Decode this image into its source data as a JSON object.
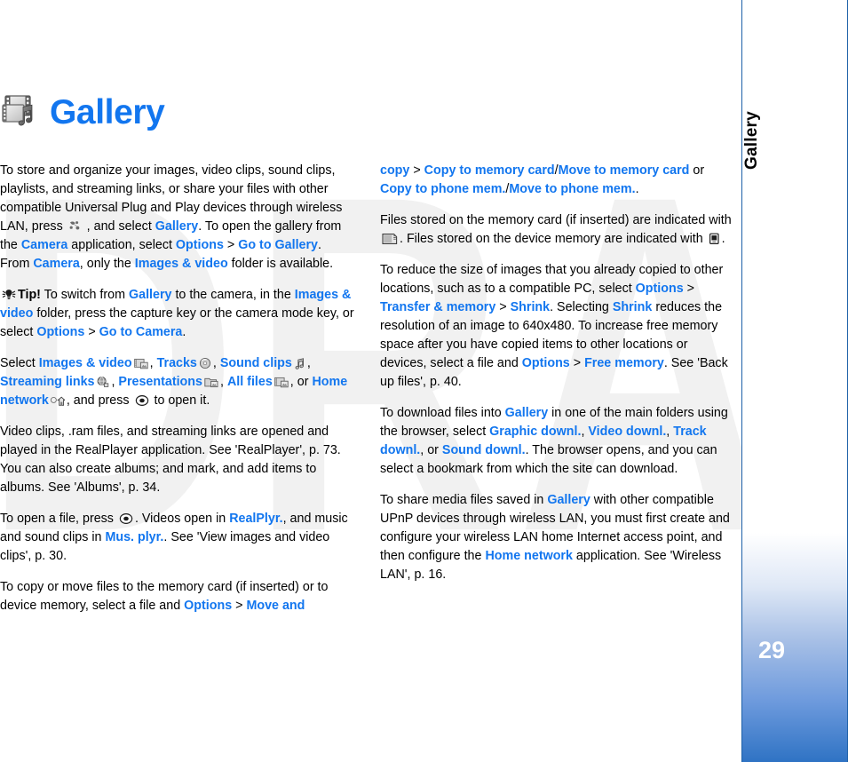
{
  "document": {
    "watermark": "DRAFT",
    "colors": {
      "accent_blue": "#1276ef",
      "sidebar_border": "#1d60a8",
      "sidebar_gradient_bottom": "#2f73c4",
      "text": "#000000",
      "watermark_gray": "#f1f1f1"
    }
  },
  "sidebar": {
    "chapter_label": "Gallery",
    "page_number": "29"
  },
  "heading": {
    "title": "Gallery",
    "icon": "gallery-filmstrip-note-icon"
  },
  "left_column": {
    "p1": {
      "t1": "To store and organize your images, video clips, sound clips, playlists, and streaming links, or share your files with other compatible Universal Plug and Play devices through wireless LAN, press ",
      "t2": " , and select ",
      "b1": "Gallery",
      "t3": ". To open the gallery from the ",
      "b2": "Camera",
      "t4": " application, select ",
      "b3": "Options",
      "sep1": " > ",
      "b4": "Go to Gallery",
      "t5": ". From ",
      "b5": "Camera",
      "t6": ", only the ",
      "b6": "Images & video",
      "t7": " folder is available."
    },
    "p2_tip": {
      "label": "Tip!",
      "t1": " To switch from ",
      "b1": "Gallery",
      "t2": " to the camera, in the ",
      "b2": "Images & video",
      "t3": " folder, press the capture key or the camera mode key, or select ",
      "b3": "Options",
      "sep1": " > ",
      "b4": "Go to Camera",
      "t4": "."
    },
    "p3": {
      "t1": "Select ",
      "b1": "Images & video",
      "t2": ", ",
      "b2": "Tracks",
      "t3": ", ",
      "b3": "Sound clips",
      "t4": ", ",
      "b4": "Streaming links",
      "t5": ", ",
      "b5": "Presentations",
      "t6": ", ",
      "b6": "All files",
      "t7": ", or ",
      "b7": "Home network",
      "t8": ", and press ",
      "t9": " to open it."
    },
    "p4": "Video clips, .ram files, and streaming links are opened and played in the RealPlayer application. See 'RealPlayer', p. 73. You can also create albums; and mark, and add items to albums. See 'Albums', p. 34.",
    "p5": {
      "t1": "To open a file, press ",
      "t2": ". Videos open in ",
      "b1": "RealPlyr.",
      "t3": ", and music and sound clips in ",
      "b2": "Mus. plyr.",
      "t4": ". See 'View images and video clips', p. 30."
    },
    "p6": {
      "t1": "To copy or move files to the memory card (if inserted) or to device memory, select a file and ",
      "b1": "Options",
      "sep1": " > ",
      "b2": "Move and"
    }
  },
  "right_column": {
    "p1": {
      "b0": "copy",
      "sep1": " > ",
      "b1": "Copy to memory card",
      "slash1": "/",
      "b2": "Move to memory card",
      "t1": " or ",
      "b3": "Copy to phone mem.",
      "slash2": "/",
      "b4": "Move to phone mem.",
      "t2": "."
    },
    "p2": {
      "t1": "Files stored on the memory card (if inserted) are indicated with ",
      "t2": ". Files stored on the device memory are indicated with ",
      "t3": "."
    },
    "p3": {
      "t1": "To reduce the size of images that you already copied to other locations, such as to a compatible PC, select ",
      "b1": "Options",
      "sep1": " > ",
      "b2": "Transfer & memory",
      "sep2": " > ",
      "b3": "Shrink",
      "t2": ". Selecting ",
      "b4": "Shrink",
      "t3": " reduces the resolution of an image to 640x480. To increase free memory space after you have copied items to other locations or devices, select a file and ",
      "b5": "Options",
      "sep3": " > ",
      "b6": "Free memory",
      "t4": ". See 'Back up files', p. 40."
    },
    "p4": {
      "t1": "To download files into ",
      "b1": "Gallery",
      "t2": " in one of the main folders using the browser, select ",
      "b2": "Graphic downl.",
      "t3": ", ",
      "b3": "Video downl.",
      "t4": ", ",
      "b4": "Track downl.",
      "t5": ", or ",
      "b5": "Sound downl.",
      "t6": ". The browser opens, and you can select a bookmark from which the site can download."
    },
    "p5": {
      "t1": "To share media files saved in ",
      "b1": "Gallery",
      "t2": " with other compatible UPnP devices through wireless LAN, you must first create and configure your wireless LAN home Internet access point, and then configure the ",
      "b2": "Home network",
      "t3": " application. See 'Wireless LAN', p. 16."
    }
  }
}
